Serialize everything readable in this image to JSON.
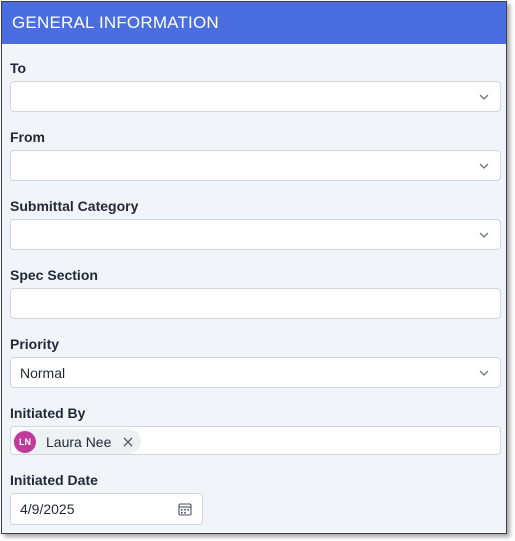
{
  "panel": {
    "title": "GENERAL INFORMATION"
  },
  "fields": {
    "to": {
      "label": "To",
      "value": ""
    },
    "from": {
      "label": "From",
      "value": ""
    },
    "submittal_category": {
      "label": "Submittal Category",
      "value": ""
    },
    "spec_section": {
      "label": "Spec Section",
      "value": ""
    },
    "priority": {
      "label": "Priority",
      "value": "Normal"
    },
    "initiated_by": {
      "label": "Initiated By",
      "chip": {
        "initials": "LN",
        "name": "Laura Nee"
      }
    },
    "initiated_date": {
      "label": "Initiated Date",
      "value": "4/9/2025"
    }
  },
  "colors": {
    "header_bg": "#4a6ee0",
    "panel_bg": "#f1f5f9",
    "avatar_bg": "#c0399b"
  },
  "icons": {
    "dropdown": "chevron-down-icon",
    "remove": "close-icon",
    "date": "calendar-icon"
  }
}
